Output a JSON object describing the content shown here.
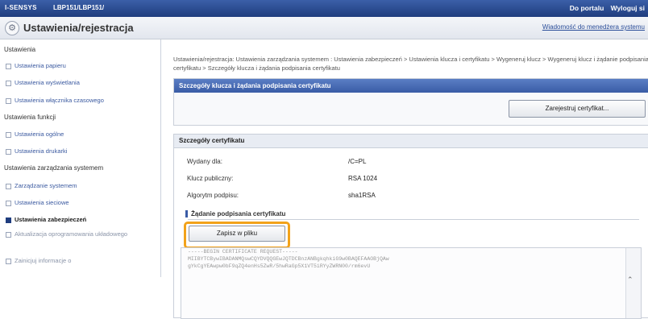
{
  "topbar": {
    "brand": "I-SENSYS",
    "model": "LBP151/LBP151/",
    "links": [
      "Do portalu",
      "Wyloguj si"
    ]
  },
  "header": {
    "title": "Ustawienia/rejestracja",
    "admin_link": "Wiadomość do menedżera systemu",
    "icon": "gear-icon"
  },
  "sidebar": {
    "sections": [
      {
        "label": "Ustawienia",
        "items": [
          {
            "label": "Ustawienia papieru"
          },
          {
            "label": "Ustawienia wyświetlania"
          },
          {
            "label": "Ustawienia włącznika czasowego"
          }
        ]
      },
      {
        "label": "Ustawienia funkcji",
        "items": [
          {
            "label": "Ustawienia ogólne"
          },
          {
            "label": "Ustawienia drukarki"
          }
        ]
      },
      {
        "label": "Ustawienia zarządzania systemem",
        "items": [
          {
            "label": "Zarządzanie systemem"
          },
          {
            "label": "Ustawienia sieciowe"
          },
          {
            "label": "Ustawienia zabezpieczeń",
            "active": true
          },
          {
            "label": "Aktualizacja oprogramowania układowego",
            "muted": true
          },
          {
            "label": "Zainicjuj informacje o",
            "muted": true
          }
        ]
      }
    ]
  },
  "breadcrumb": "Ustawienia/rejestracja: Ustawienia zarządzania systemem : Ustawienia zabezpieczeń > Ustawienia klucza i certyfikatu > Wygeneruj klucz > Wygeneruj klucz i żądanie podpisania certyfikatu > Szczegóły klucza i żądania podpisania certyfikatu",
  "panel_csr": {
    "title": "Szczegóły klucza i żądania podpisania certyfikatu",
    "register_button": "Zarejestruj certyfikat..."
  },
  "cert_details": {
    "title": "Szczegóły certyfikatu",
    "rows": [
      {
        "label": "Wydany dla:",
        "value": "/C=PL"
      },
      {
        "label": "Klucz publiczny:",
        "value": "RSA 1024"
      },
      {
        "label": "Algorytm podpisu:",
        "value": "sha1RSA"
      }
    ]
  },
  "csr_section": {
    "title": "Żądanie podpisania certyfikatu",
    "save_button": "Zapisz w pliku",
    "text_lines": [
      "-----BEGIN CERTIFICATE REQUEST-----",
      "MIIBYTCBywIBADANMQswCQYDVQQGEwJQTDCBnzANBgkqhkiG9w0BAQEFAAOBjQAw",
      "gYkCgYEAwpw0bF9qZQ4enHs5ZwR/5hwRaGp5X1VT5iRYyZWRN00/rm6evU"
    ]
  },
  "colors": {
    "accent": "#3a5ca6",
    "highlight": "#f2a21a"
  }
}
